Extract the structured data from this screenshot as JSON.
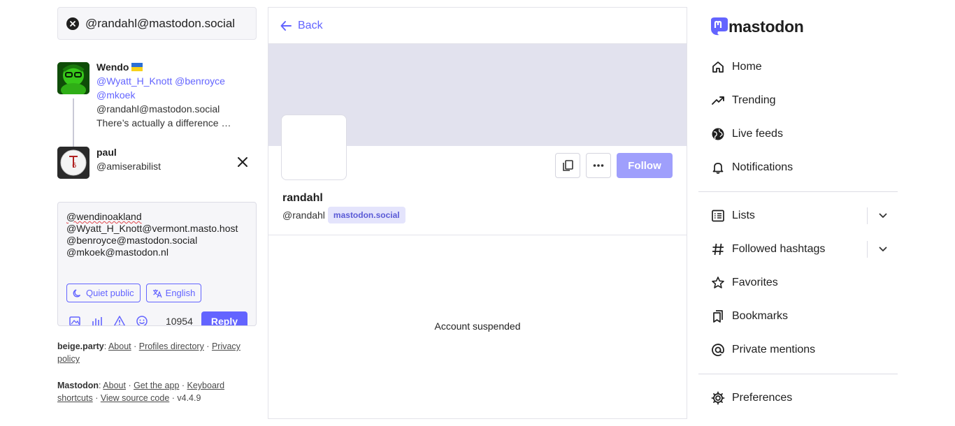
{
  "search": {
    "value": "@randahl@mastodon.social"
  },
  "thread": {
    "parent": {
      "author": "Wendo",
      "mentions_line1": "@Wyatt_H_Knott @benroyce",
      "mentions_line2": "@mkoek",
      "excerpt_line1": "@randahl@mastodon.social",
      "excerpt_line2": "There’s actually a difference …"
    },
    "reply_to": {
      "author": "paul",
      "handle": "@amiserabilist"
    }
  },
  "composer": {
    "first_mention": "@wendinoakland",
    "text_rest": "@Wyatt_H_Knott@vermont.masto.host\n@benroyce@mastodon.social\n@mkoek@mastodon.nl",
    "visibility": "Quiet public",
    "language": "English",
    "char_count": "10954",
    "reply_label": "Reply"
  },
  "footer": {
    "server": {
      "name": "beige.party",
      "about": "About",
      "directory": "Profiles directory",
      "privacy": "Privacy policy"
    },
    "app": {
      "name": "Mastodon",
      "about": "About",
      "get_app": "Get the app",
      "shortcuts": "Keyboard shortcuts",
      "source": "View source code",
      "version": "v4.4.9"
    }
  },
  "profile": {
    "back_label": "Back",
    "display_name": "randahl",
    "acct": "@randahl",
    "domain": "mastodon.social",
    "follow_label": "Follow",
    "status_message": "Account suspended"
  },
  "nav": {
    "logo_text": "mastodon",
    "items": [
      {
        "label": "Home",
        "icon": "home-icon"
      },
      {
        "label": "Trending",
        "icon": "trending-icon"
      },
      {
        "label": "Live feeds",
        "icon": "globe-icon"
      },
      {
        "label": "Notifications",
        "icon": "bell-icon"
      }
    ],
    "items2": [
      {
        "label": "Lists",
        "icon": "list-icon"
      },
      {
        "label": "Followed hashtags",
        "icon": "hashtag-icon"
      },
      {
        "label": "Favorites",
        "icon": "star-icon"
      },
      {
        "label": "Bookmarks",
        "icon": "bookmarks-icon"
      },
      {
        "label": "Private mentions",
        "icon": "at-icon"
      }
    ],
    "preferences": {
      "label": "Preferences",
      "icon": "gear-icon"
    }
  },
  "colors": {
    "accent": "#6364ff",
    "follow_disabled": "#9f9ffc",
    "header": "#e2e2ee"
  }
}
